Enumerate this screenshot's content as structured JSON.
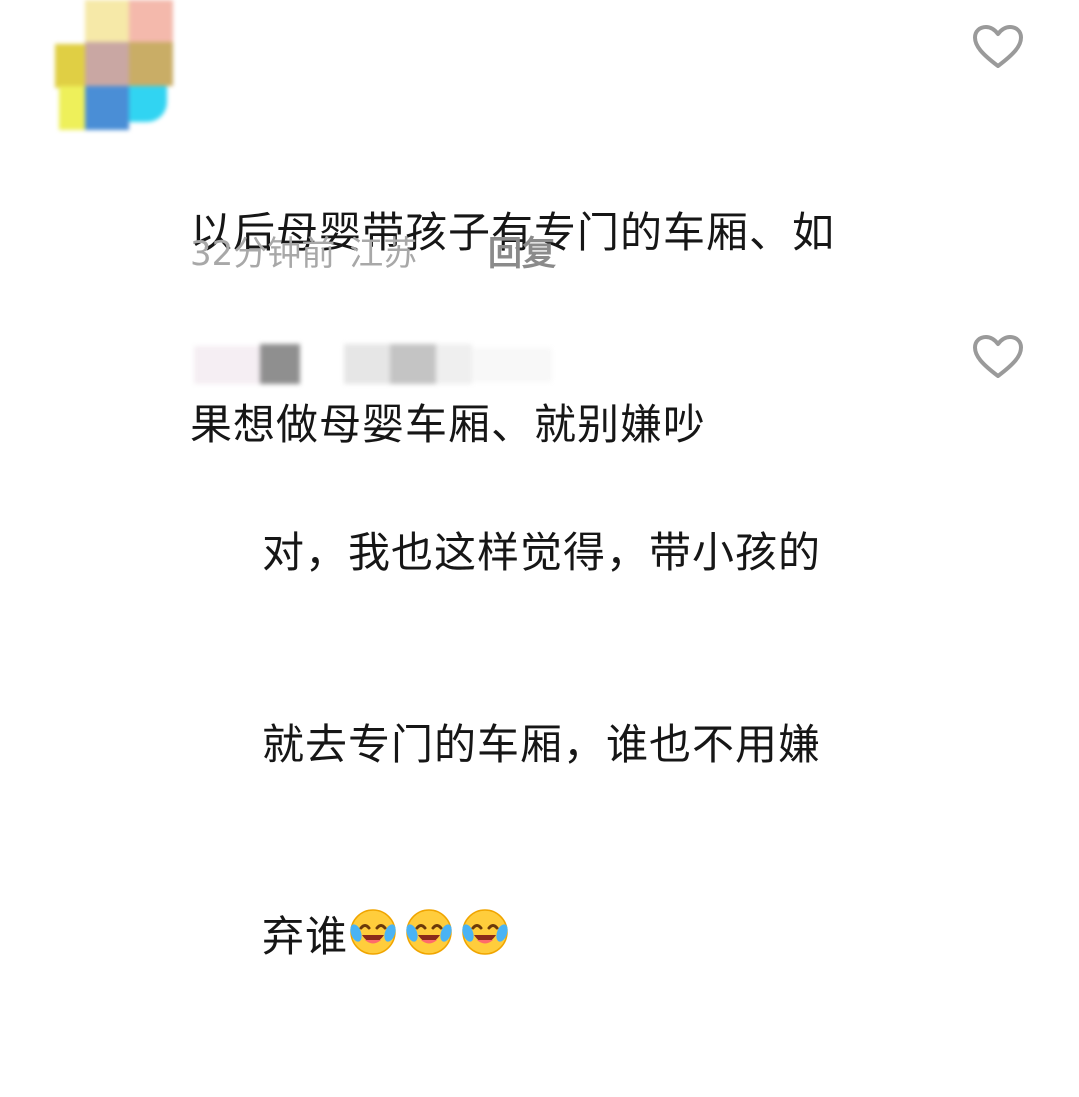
{
  "comments": [
    {
      "avatar_icon": "avatar-icon",
      "text_lines": [
        "以后母婴带孩子有专门的车厢、如",
        "果想做母婴车厢、就别嫌吵"
      ],
      "time": "32分钟前",
      "location": "江苏",
      "reply_label": "回复",
      "like_icon": "heart-outline-icon"
    },
    {
      "text_lines": [
        "对，我也这样觉得，带小孩的",
        "就去专门的车厢，谁也不用嫌",
        "弃谁"
      ],
      "emojis": [
        "laugh-cry-emoji",
        "laugh-cry-emoji",
        "laugh-cry-emoji"
      ],
      "like_icon": "heart-outline-icon"
    }
  ],
  "colors": {
    "text": "#161616",
    "meta": "#a8a8a8",
    "reply": "#8a8a8a",
    "icon": "#9a9a9a"
  }
}
